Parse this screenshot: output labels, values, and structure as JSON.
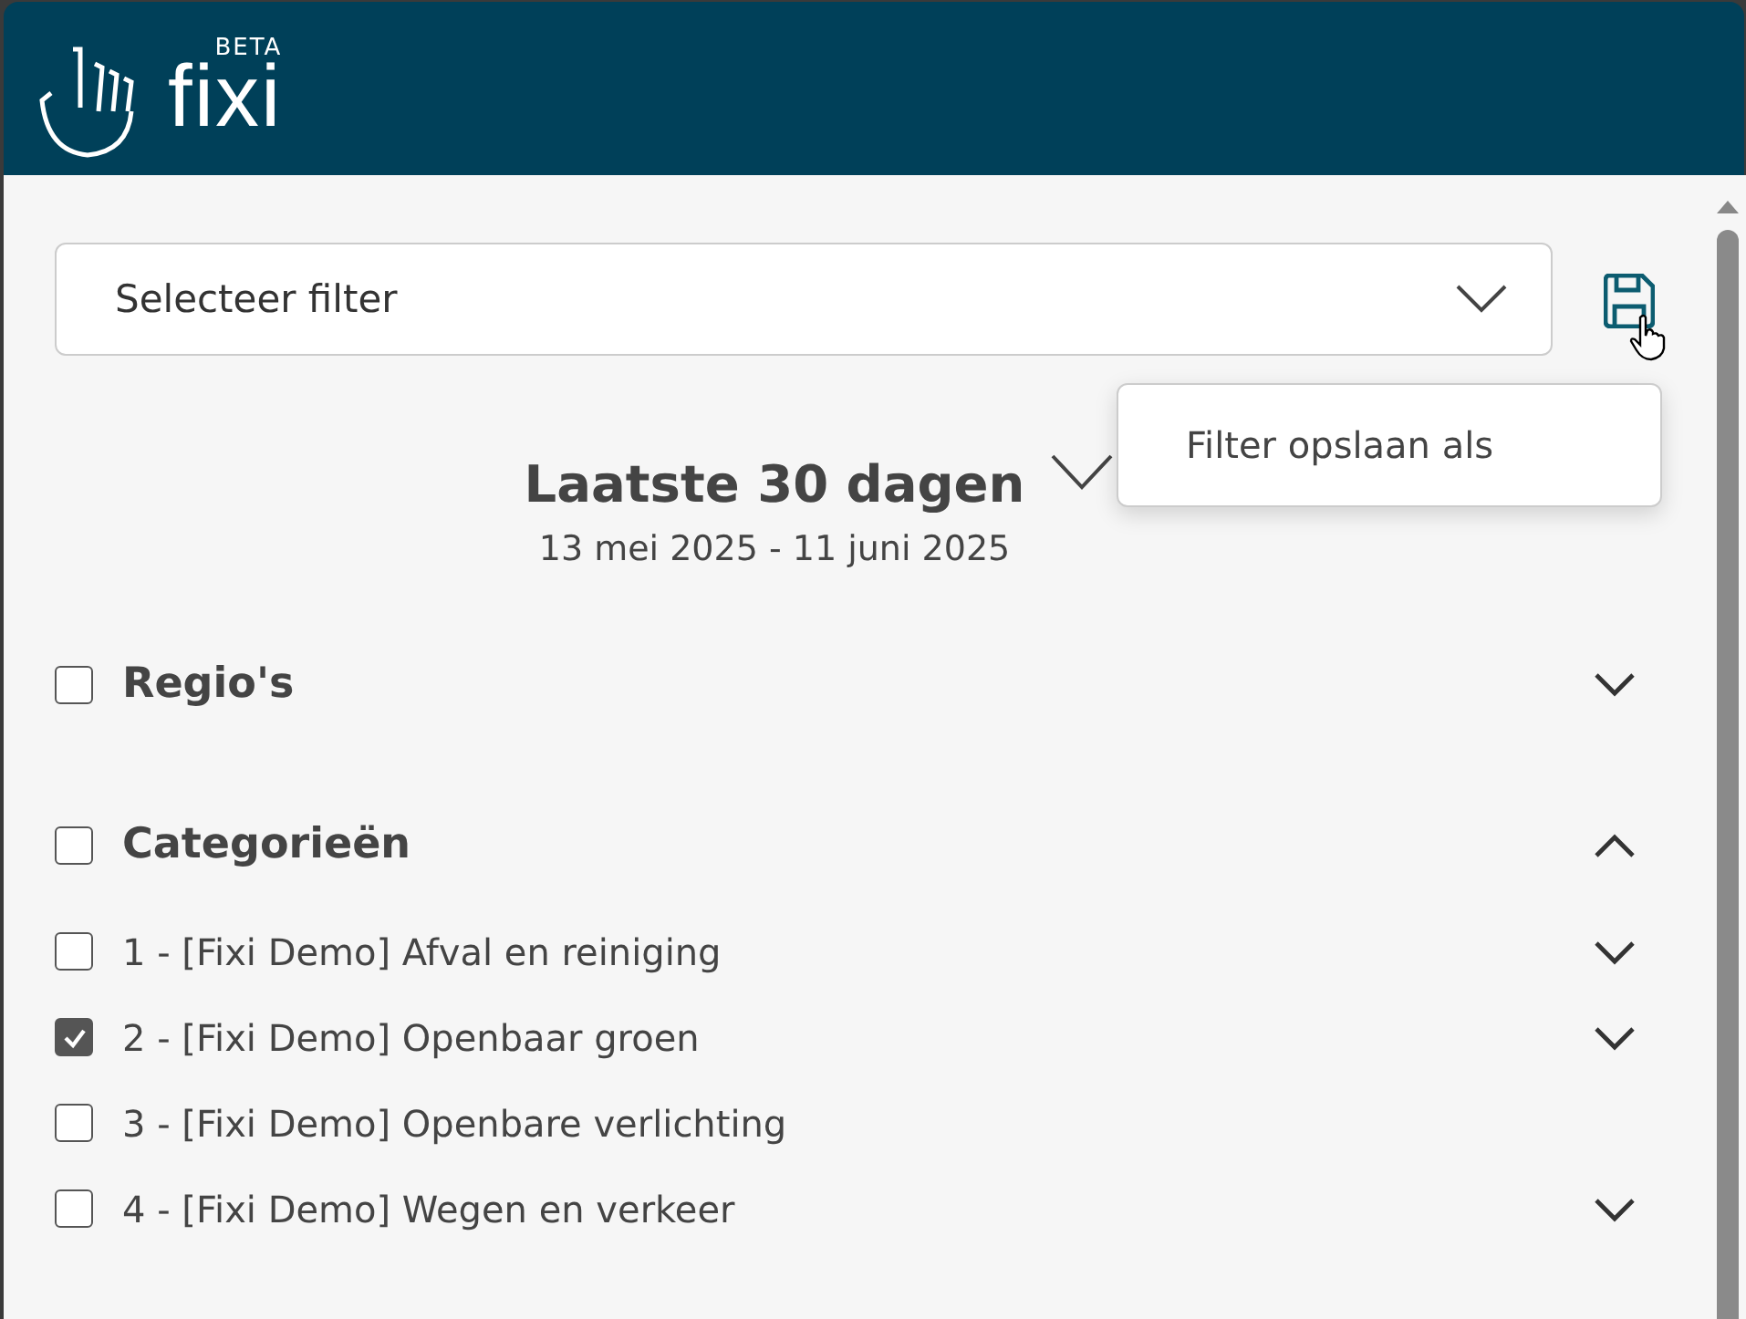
{
  "header": {
    "logo_text": "fixi",
    "badge": "BETA"
  },
  "filter_select": {
    "placeholder": "Selecteer filter"
  },
  "save_menu": {
    "items": [
      "Filter opslaan als"
    ]
  },
  "period": {
    "title": "Laatste 30 dagen",
    "range": "13 mei 2025 - 11 juni 2025"
  },
  "sections": [
    {
      "label": "Regio's",
      "checked": false,
      "expanded": false
    },
    {
      "label": "Categorieën",
      "checked": false,
      "expanded": true,
      "children": [
        {
          "label": "1 - [Fixi Demo] Afval en reiniging",
          "checked": false,
          "expandable": true
        },
        {
          "label": "2 - [Fixi Demo] Openbaar groen",
          "checked": true,
          "expandable": true
        },
        {
          "label": "3 - [Fixi Demo] Openbare verlichting",
          "checked": false,
          "expandable": false
        },
        {
          "label": "4 - [Fixi Demo] Wegen en verkeer",
          "checked": false,
          "expandable": true
        }
      ]
    }
  ]
}
